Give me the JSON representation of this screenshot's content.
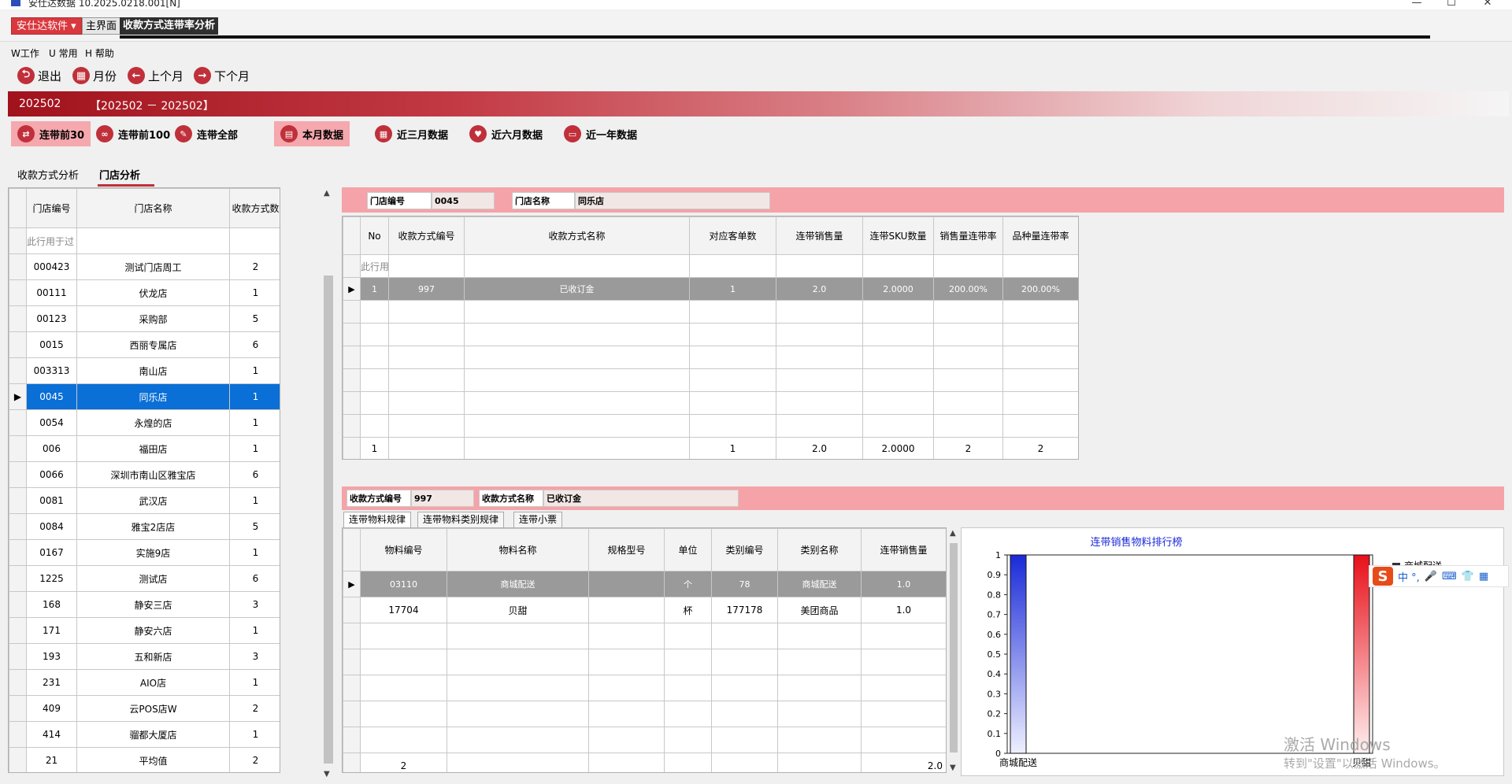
{
  "window": {
    "title": "安仕达数据    10.2025.0218.001[N]"
  },
  "tabs": {
    "brand": "安仕达软件",
    "main": "主界面",
    "analysis": "收款方式连带率分析"
  },
  "menu": {
    "items": [
      "W工作",
      "U 常用",
      "H 帮助"
    ]
  },
  "toolbar": {
    "exit": "退出",
    "month": "月份",
    "prev": "上个月",
    "next": "下个月"
  },
  "period": {
    "current": "202502",
    "range": "【202502 － 202502】"
  },
  "filters": {
    "top30": "连带前30",
    "top100": "连带前100",
    "all": "连带全部",
    "this_month": "本月数据",
    "three_months": "近三月数据",
    "six_months": "近六月数据",
    "one_year": "近一年数据"
  },
  "subtabs": {
    "payment": "收款方式分析",
    "store": "门店分析"
  },
  "left_grid": {
    "headers": [
      "门店编号",
      "门店名称",
      "收款方式数"
    ],
    "filter_hint": "此行用于过",
    "rows": [
      [
        "000423",
        "测试门店周工",
        "2"
      ],
      [
        "00111",
        "伏龙店",
        "1"
      ],
      [
        "00123",
        "采购部",
        "5"
      ],
      [
        "0015",
        "西丽专属店",
        "6"
      ],
      [
        "003313",
        "南山店",
        "1"
      ],
      [
        "0045",
        "同乐店",
        "1"
      ],
      [
        "0054",
        "永煌的店",
        "1"
      ],
      [
        "006",
        "福田店",
        "1"
      ],
      [
        "0066",
        "深圳市南山区雅宝店",
        "6"
      ],
      [
        "0081",
        "武汉店",
        "1"
      ],
      [
        "0084",
        "雅宝2店店",
        "5"
      ],
      [
        "0167",
        "实施9店",
        "1"
      ],
      [
        "1225",
        "测试店",
        "6"
      ],
      [
        "168",
        "静安三店",
        "3"
      ],
      [
        "171",
        "静安六店",
        "1"
      ],
      [
        "193",
        "五和新店",
        "3"
      ],
      [
        "231",
        "AIO店",
        "1"
      ],
      [
        "409",
        "云POS店W",
        "2"
      ],
      [
        "414",
        "骝都大厦店",
        "1"
      ],
      [
        "21",
        "平均值",
        "2"
      ]
    ]
  },
  "store_info": {
    "code_label": "门店编号",
    "code_value": "0045",
    "name_label": "门店名称",
    "name_value": "同乐店"
  },
  "top_grid": {
    "headers": [
      "No",
      "收款方式编号",
      "收款方式名称",
      "对应客单数",
      "连带销售量",
      "连带SKU数量",
      "销售量连带率",
      "品种量连带率"
    ],
    "filter_hint": "此行用",
    "rows": [
      [
        "1",
        "997",
        "已收订金",
        "1",
        "2.0",
        "2.0000",
        "200.00%",
        "200.00%"
      ]
    ],
    "totals": [
      "1",
      "",
      "",
      "1",
      "2.0",
      "2.0000",
      "2",
      "2"
    ]
  },
  "pay_info": {
    "code_label": "收款方式编号",
    "code_value": "997",
    "name_label": "收款方式名称",
    "name_value": "已收订金"
  },
  "bottom_tabs": [
    "连带物料规律",
    "连带物料类别规律",
    "连带小票"
  ],
  "bottom_grid": {
    "headers": [
      "物料编号",
      "物料名称",
      "规格型号",
      "单位",
      "类别编号",
      "类别名称",
      "连带销售量"
    ],
    "rows": [
      [
        "03110",
        "商城配送",
        "",
        "个",
        "78",
        "商城配送",
        "1.0"
      ],
      [
        "17704",
        "贝甜",
        "",
        "杯",
        "177178",
        "美团商品",
        "1.0"
      ]
    ],
    "totals": [
      "2",
      "",
      "",
      "",
      "",
      "",
      "2.0"
    ]
  },
  "chart_data": {
    "type": "bar",
    "title": "连带销售物料排行榜",
    "categories": [
      "商城配送",
      "贝甜"
    ],
    "values": [
      1,
      1
    ],
    "ylim": [
      0,
      1
    ],
    "yticks": [
      "0",
      "0.1",
      "0.2",
      "0.3",
      "0.4",
      "0.5",
      "0.6",
      "0.7",
      "0.8",
      "0.9",
      "1"
    ],
    "colors": [
      "#1a2ad8",
      "#e8101a"
    ],
    "legend_item": "商城配送"
  },
  "ime": {
    "text": "中 °, "
  },
  "watermark": {
    "line1": "激活 Windows",
    "line2": "转到\"设置\"以激活 Windows。"
  }
}
